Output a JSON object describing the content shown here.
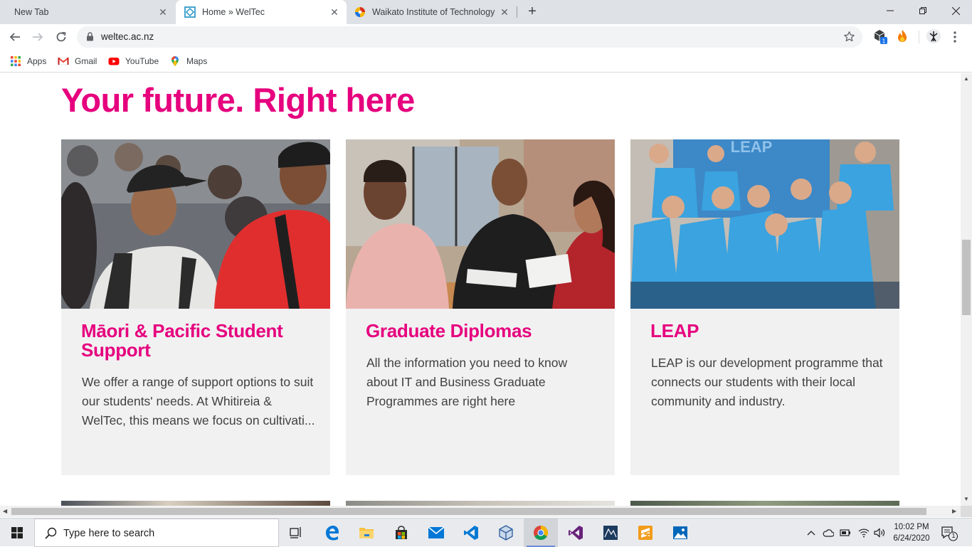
{
  "browser": {
    "tabs": [
      {
        "title": "New Tab",
        "active": false
      },
      {
        "title": "Home » WelTec",
        "active": true
      },
      {
        "title": "Waikato Institute of Technology",
        "active": false
      }
    ],
    "url": "weltec.ac.nz",
    "bookmarks": [
      {
        "label": "Apps",
        "icon": "apps-grid-icon"
      },
      {
        "label": "Gmail",
        "icon": "gmail-icon"
      },
      {
        "label": "YouTube",
        "icon": "youtube-icon"
      },
      {
        "label": "Maps",
        "icon": "maps-pin-icon"
      }
    ],
    "extension_badge": "1"
  },
  "page": {
    "headline": "Your future. Right here",
    "accent_color": "#e6007e",
    "cards": [
      {
        "title": "Māori & Pacific Student Support",
        "text": "We offer a range of support options to suit our students' needs. At Whitireia & WelTec, this means we focus on cultivati...",
        "image": "students-laughing-photo"
      },
      {
        "title": "Graduate Diplomas",
        "text": "All the information you need to know about IT and Business Graduate Programmes are right here",
        "image": "advisor-meeting-photo"
      },
      {
        "title": "LEAP",
        "text": "LEAP is our development programme that connects our students with their local community and industry.",
        "image": "leap-group-photo"
      }
    ]
  },
  "taskbar": {
    "search_placeholder": "Type here to search",
    "time": "10:02 PM",
    "date": "6/24/2020",
    "notification_count": "1"
  }
}
